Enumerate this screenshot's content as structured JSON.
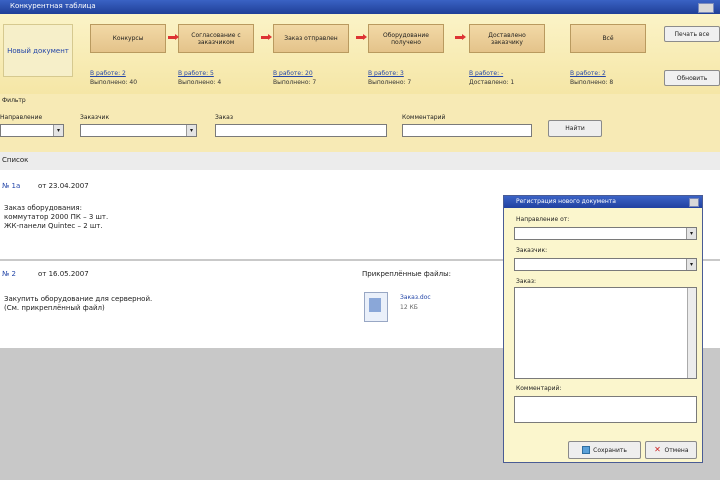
{
  "window": {
    "title": "Конкурентная таблица"
  },
  "flow": {
    "new_doc": "Новый документ",
    "stages": [
      {
        "label": "Конкурсы",
        "work": "В работе: 2",
        "done": "Выполнено: 40"
      },
      {
        "label": "Согласование с заказчиком",
        "work": "В работе: 5",
        "done": "Выполнено: 4"
      },
      {
        "label": "Заказ отправлен",
        "work": "В работе: 20",
        "done": "Выполнено: 7"
      },
      {
        "label": "Оборудование получено",
        "work": "В работе: 3",
        "done": "Выполнено: 7"
      },
      {
        "label": "Доставлено заказчику",
        "work": "В работе: -",
        "done": "Доставлено: 1"
      },
      {
        "label": "Всё",
        "work": "В работе: 2",
        "done": "Выполнено: 8"
      }
    ],
    "print_button": "Печать все",
    "refresh_button": "Обновить"
  },
  "filter": {
    "section_label": "Фильтр",
    "fields": [
      "Направление",
      "Заказчик",
      "Заказ",
      "Комментарий"
    ],
    "find_button": "Найти"
  },
  "list": {
    "header": "Список"
  },
  "docs": [
    {
      "number": "№ 1а",
      "date": "от 23.04.2007",
      "lines": [
        "Заказ оборудования:",
        "коммутатор 2000 ПК – 3 шт.",
        "ЖК-панели Quintec – 2 шт."
      ]
    },
    {
      "number": "№ 2",
      "date": "от 16.05.2007",
      "lines": [
        "Закупить оборудование для серверной.",
        "(См. прикреплённый файл)"
      ],
      "attachments_label": "Прикреплённые файлы:",
      "file_name": "Заказ.doc",
      "file_size": "12 КБ"
    }
  ],
  "dialog": {
    "title": "Регистрация нового документа",
    "fields": [
      "Направление от:",
      "Заказчик:",
      "Заказ:",
      "Комментарий:"
    ],
    "save_button": "Сохранить",
    "cancel_button": "Отмена"
  }
}
